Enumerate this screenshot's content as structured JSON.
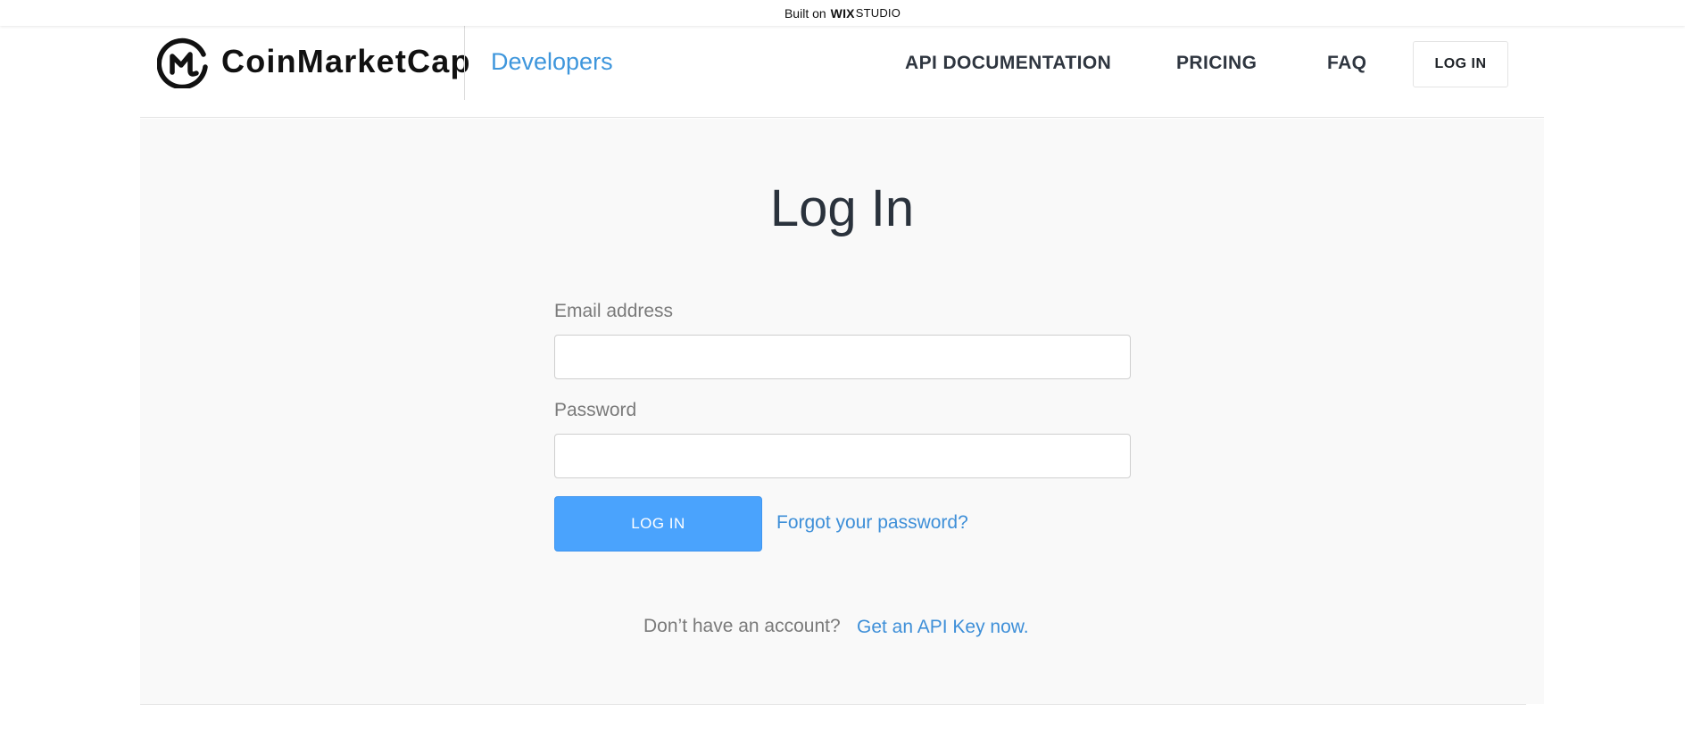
{
  "wix_bar": {
    "built_on": "Built on",
    "brand": "WIX",
    "product": "STUDIO"
  },
  "header": {
    "brand_name": "CoinMarketCap",
    "section": "Developers",
    "nav": {
      "api_docs": "API DOCUMENTATION",
      "pricing": "PRICING",
      "faq": "FAQ"
    },
    "login_button": "LOG IN"
  },
  "form": {
    "title": "Log In",
    "email_label": "Email address",
    "email_value": "",
    "password_label": "Password",
    "password_value": "",
    "submit_label": "LOG IN",
    "forgot_link": "Forgot your password?",
    "no_account_text": "Don’t have an account?",
    "signup_link": "Get an API Key now."
  },
  "icons": [
    "coinmarketcap-logo-icon"
  ],
  "colors": {
    "accent": "#3e96dc",
    "button": "#4aa3fd",
    "heading": "#2a323c",
    "muted": "#7a7a7a"
  }
}
